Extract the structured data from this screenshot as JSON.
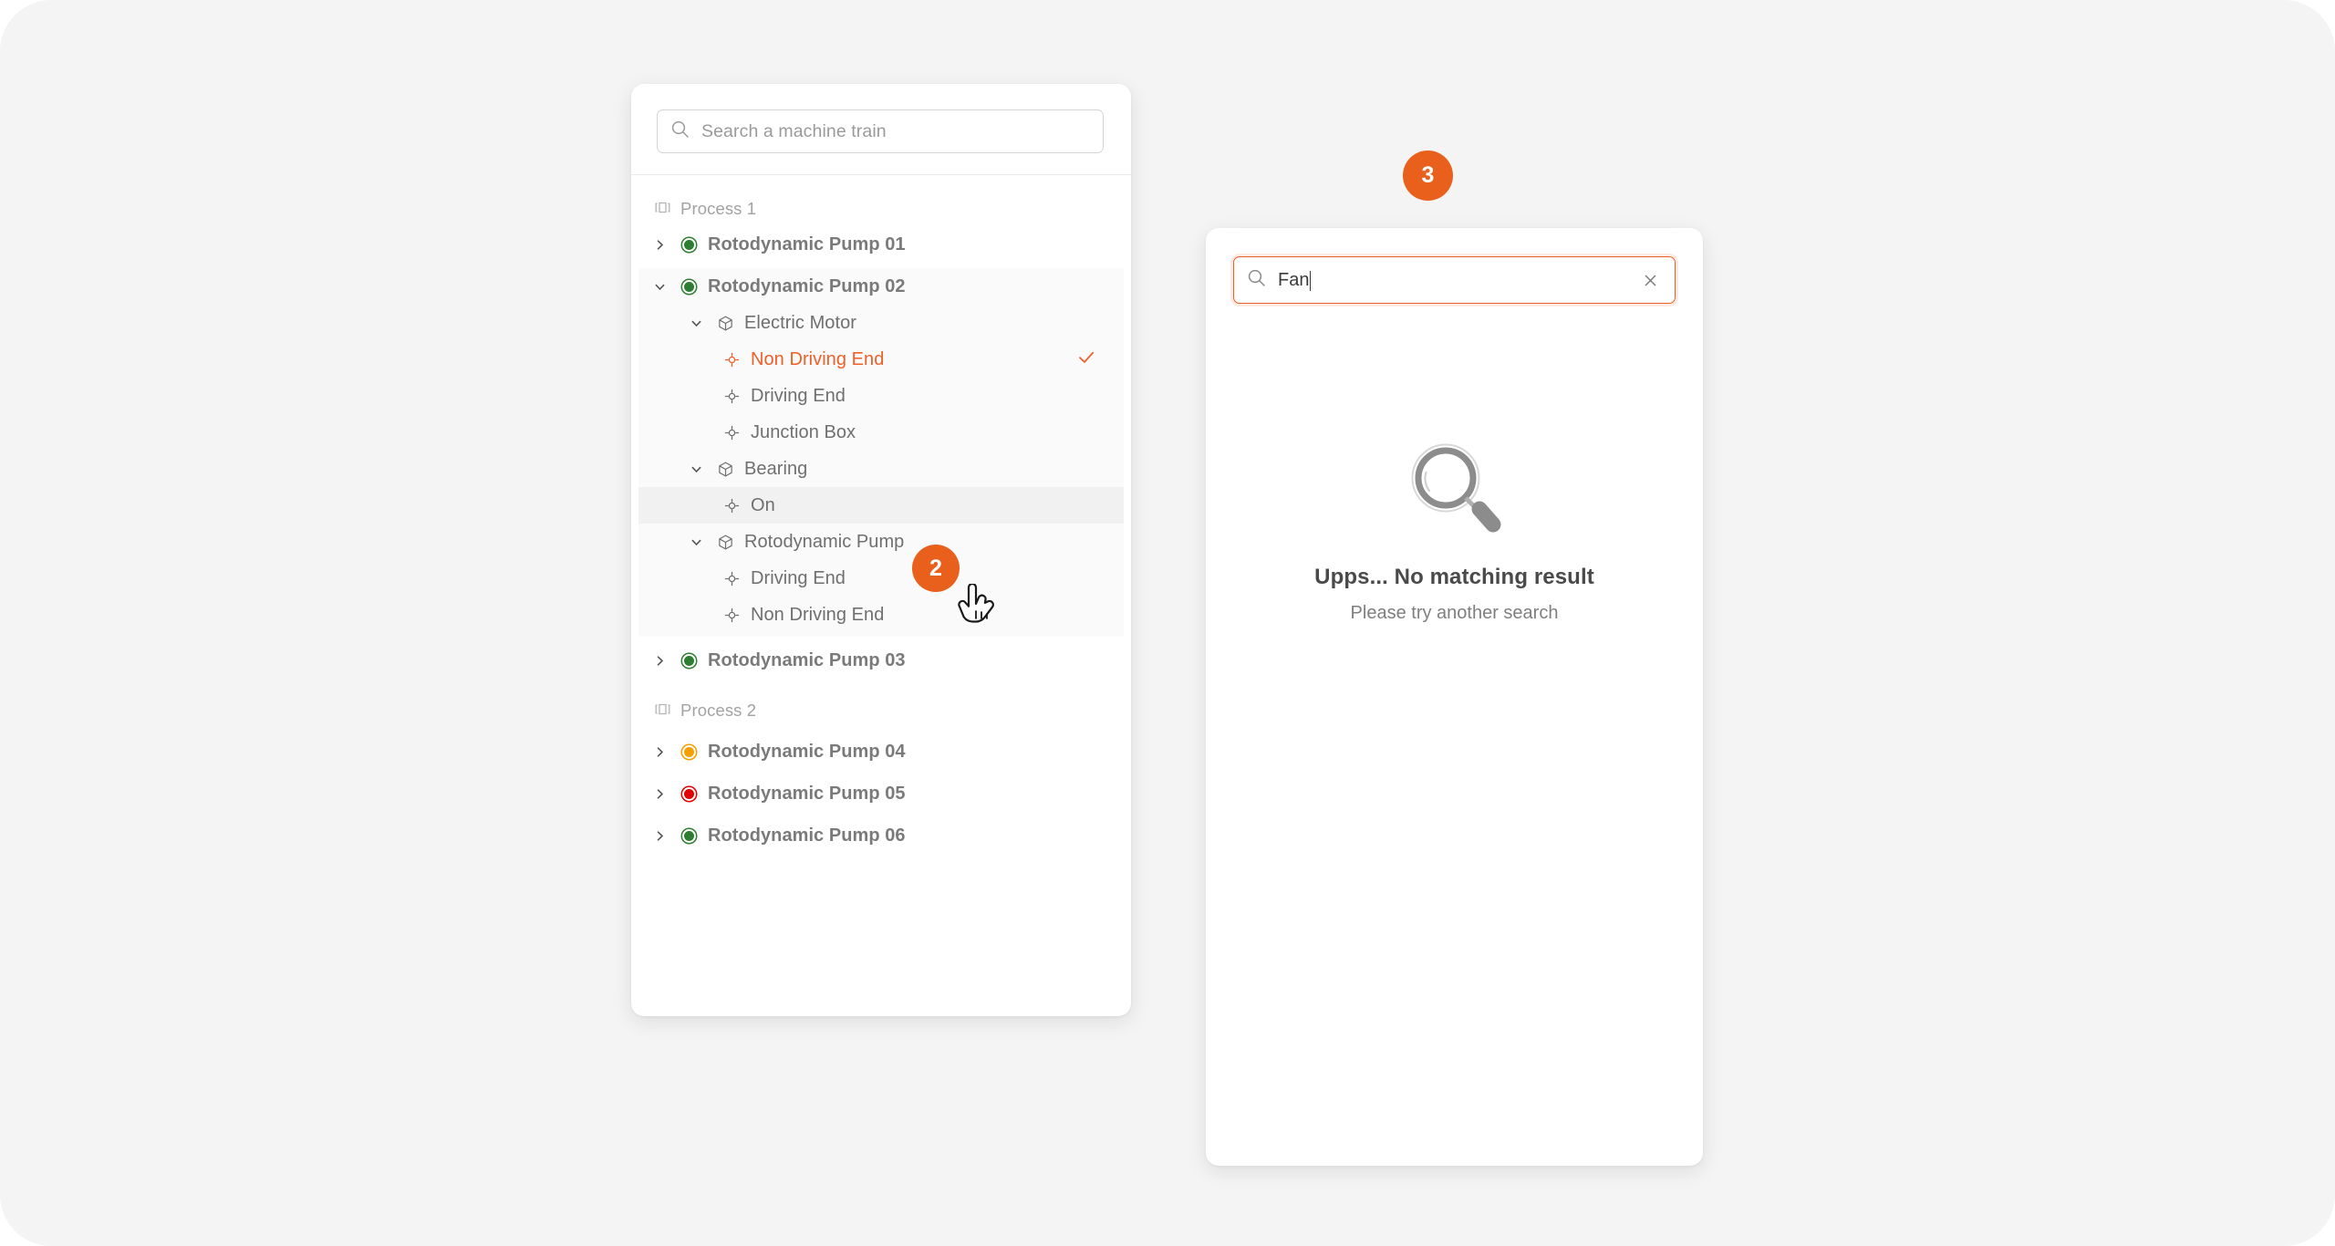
{
  "colors": {
    "accent": "#ef5f28",
    "badge": "#e8601c",
    "status_ok": "#2e7d32",
    "status_warn": "#f5a000",
    "status_alarm": "#e00000",
    "canvas": "#f4f4f4",
    "panel": "#ffffff"
  },
  "tree_panel": {
    "search": {
      "placeholder": "Search a machine train",
      "icon": "search-icon"
    },
    "groups": [
      {
        "icon": "process-icon",
        "label": "Process 1",
        "machines": [
          {
            "label": "Rotodynamic Pump 01",
            "status": "ok",
            "expanded": false,
            "chevron": "chevron-right-icon"
          },
          {
            "label": "Rotodynamic Pump 02",
            "status": "ok",
            "expanded": true,
            "chevron": "chevron-down-icon",
            "components": [
              {
                "label": "Electric Motor",
                "icon": "cube-icon",
                "expanded": true,
                "points": [
                  {
                    "label": "Non Driving End",
                    "icon": "measurement-point-icon",
                    "selected": true,
                    "check": "check-icon"
                  },
                  {
                    "label": "Driving End",
                    "icon": "measurement-point-icon",
                    "selected": false
                  },
                  {
                    "label": "Junction Box",
                    "icon": "measurement-point-icon",
                    "selected": false
                  }
                ]
              },
              {
                "label": "Bearing",
                "icon": "cube-icon",
                "expanded": true,
                "points": [
                  {
                    "label": "On",
                    "icon": "measurement-point-icon",
                    "selected": false,
                    "hovered": true
                  }
                ]
              },
              {
                "label": "Rotodynamic Pump",
                "icon": "cube-icon",
                "expanded": true,
                "points": [
                  {
                    "label": "Driving End",
                    "icon": "measurement-point-icon",
                    "selected": false
                  },
                  {
                    "label": "Non Driving End",
                    "icon": "measurement-point-icon",
                    "selected": false
                  }
                ]
              }
            ]
          },
          {
            "label": "Rotodynamic Pump 03",
            "status": "ok",
            "expanded": false,
            "chevron": "chevron-right-icon"
          }
        ]
      },
      {
        "icon": "process-icon",
        "label": "Process 2",
        "machines": [
          {
            "label": "Rotodynamic Pump 04",
            "status": "warn",
            "expanded": false,
            "chevron": "chevron-right-icon"
          },
          {
            "label": "Rotodynamic Pump 05",
            "status": "alarm",
            "expanded": false,
            "chevron": "chevron-right-icon"
          },
          {
            "label": "Rotodynamic Pump 06",
            "status": "ok",
            "expanded": false,
            "chevron": "chevron-right-icon"
          }
        ]
      }
    ]
  },
  "search_panel": {
    "search": {
      "value": "Fan",
      "icon": "search-icon",
      "clear_icon": "close-icon"
    },
    "empty_state": {
      "illustration": "magnifier-illustration",
      "title": "Upps... No matching result",
      "subtitle": "Please try another search"
    }
  },
  "annotations": {
    "step2": "2",
    "step3": "3",
    "cursor": "pointer-hand-cursor"
  }
}
